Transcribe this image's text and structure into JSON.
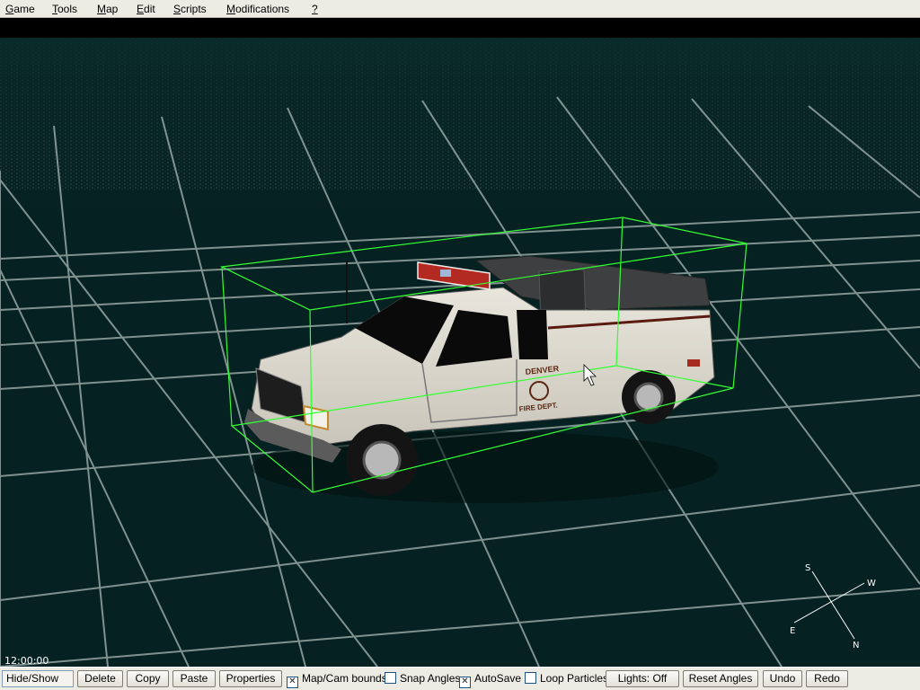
{
  "menubar": {
    "items": [
      {
        "label": "Game",
        "key": "G",
        "rest": "ame"
      },
      {
        "label": "Tools",
        "key": "T",
        "rest": "ools"
      },
      {
        "label": "Map",
        "key": "M",
        "rest": "ap"
      },
      {
        "label": "Edit",
        "key": "E",
        "rest": "dit"
      },
      {
        "label": "Scripts",
        "key": "S",
        "rest": "cripts"
      },
      {
        "label": "Modifications",
        "key": "M",
        "rest": "odifications"
      },
      {
        "label": "?",
        "key": "?",
        "rest": ""
      }
    ]
  },
  "viewport": {
    "clock": "12:00:00",
    "compass": {
      "s": "S",
      "w": "W",
      "e": "E",
      "n": "N"
    },
    "vehicle_decal": {
      "line1": "DENVER",
      "line2": "FIRE DEPT."
    },
    "colors": {
      "ground": "#062121",
      "grid": "#a8b8b6",
      "bounding_box": "#33ff33",
      "truck_body": "#dedbd2"
    }
  },
  "toolbar": {
    "hide_show": "Hide/Show",
    "delete": "Delete",
    "copy": "Copy",
    "paste": "Paste",
    "properties": "Properties",
    "map_cam_bounds": {
      "label": "Map/Cam bounds",
      "checked": true
    },
    "snap_angles": {
      "label": "Snap Angles",
      "checked": false
    },
    "autosave": {
      "label": "AutoSave",
      "checked": true
    },
    "loop_particles": {
      "label": "Loop Particles",
      "checked": false
    },
    "lights": "Lights: Off",
    "reset_angles": "Reset Angles",
    "undo": "Undo",
    "redo": "Redo"
  }
}
